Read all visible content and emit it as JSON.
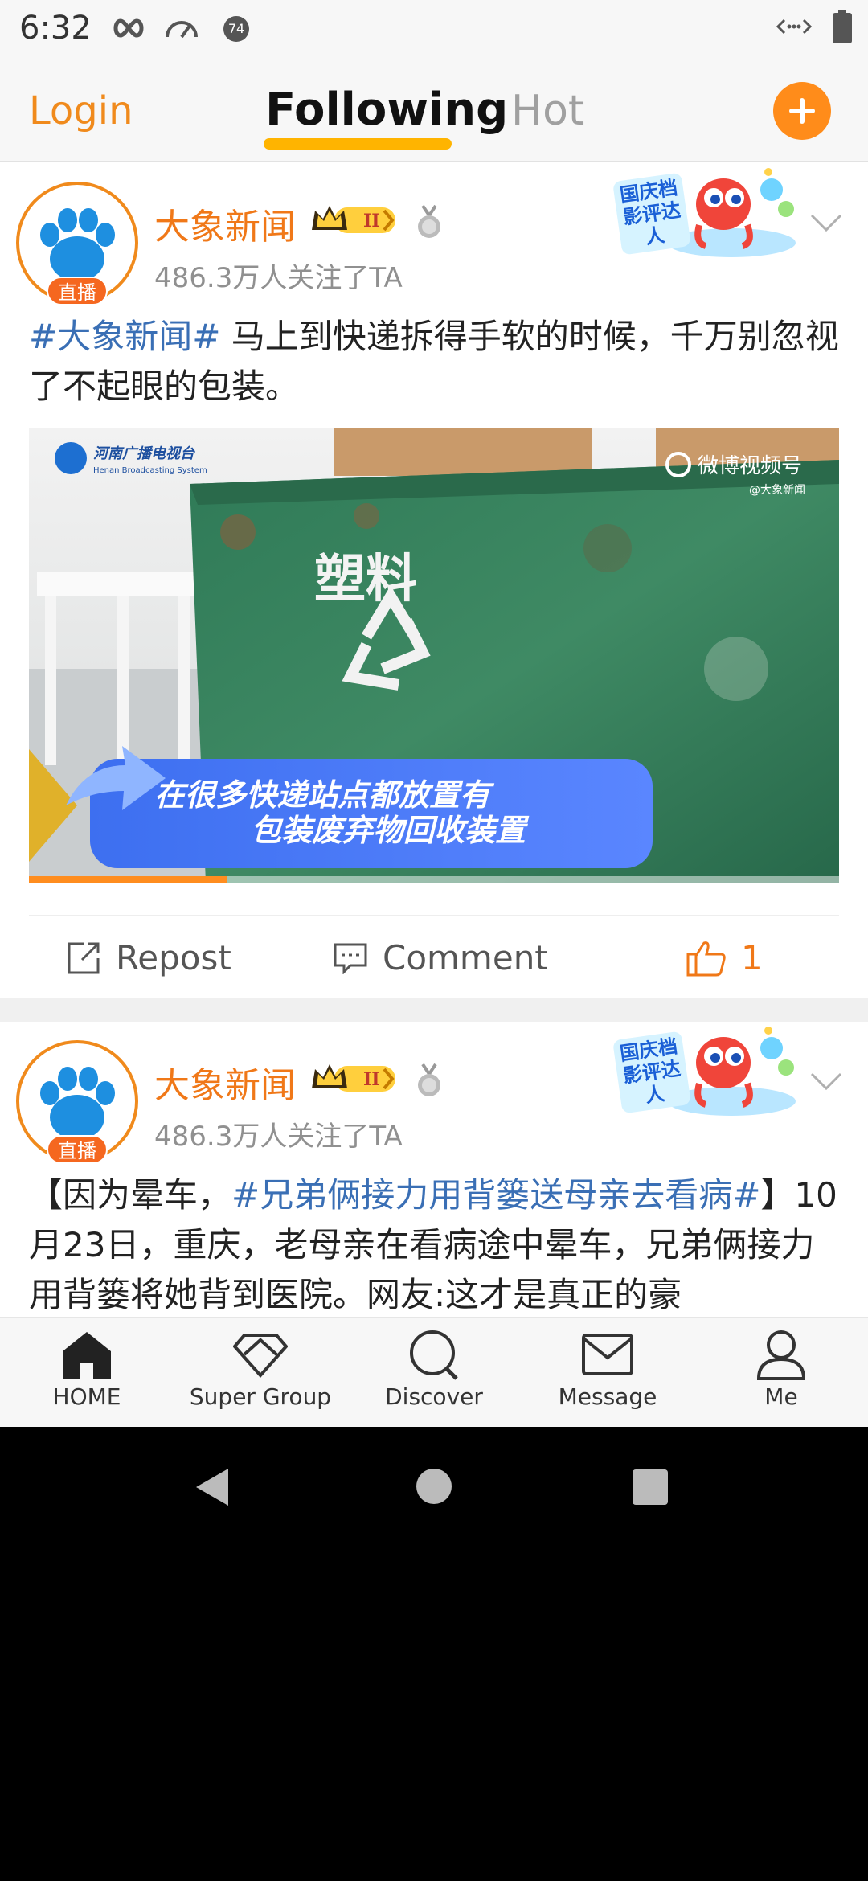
{
  "status_bar": {
    "time": "6:32",
    "notif_badge": "74"
  },
  "top_nav": {
    "login": "Login",
    "following": "Following",
    "hot": "Hot"
  },
  "posts": [
    {
      "author": "大象新闻",
      "live_badge": "直播",
      "level": "II",
      "followers": "486.3万人关注了TA",
      "promo_text": "国庆档影评达人",
      "text_tag": "#大象新闻#",
      "text_body": " 马上到快递拆得手软的时候，千万别忽视了不起眼的包装。",
      "video": {
        "station_logo": "河南广播电视台",
        "station_sub": "Henan Broadcasting System",
        "watermark": "微博视频号",
        "watermark_handle": "@大象新闻",
        "bin_label": "塑料",
        "caption_line1": "在很多快递站点都放置有",
        "caption_line2": "包装废弃物回收装置",
        "progress": 0.244
      },
      "actions": {
        "repost": "Repost",
        "comment": "Comment",
        "likes": "1"
      }
    },
    {
      "author": "大象新闻",
      "live_badge": "直播",
      "level": "II",
      "followers": "486.3万人关注了TA",
      "promo_text": "国庆档影评达人",
      "text_prefix": "【因为晕车，",
      "text_tag": "#兄弟俩接力用背篓送母亲去看病#",
      "text_suffix": "】10月23日，重庆，老母亲在看病途中晕车，兄弟俩接力用背篓将她背到医院。网友:这才是真正的豪"
    }
  ],
  "tab_bar": [
    {
      "label": "HOME",
      "icon": "home-icon"
    },
    {
      "label": "Super Group",
      "icon": "diamond-icon"
    },
    {
      "label": "Discover",
      "icon": "search-icon"
    },
    {
      "label": "Message",
      "icon": "envelope-icon"
    },
    {
      "label": "Me",
      "icon": "person-icon"
    }
  ],
  "colors": {
    "accent": "#f08a1c",
    "tag": "#3a6fb5",
    "underline": "#ffb400"
  }
}
